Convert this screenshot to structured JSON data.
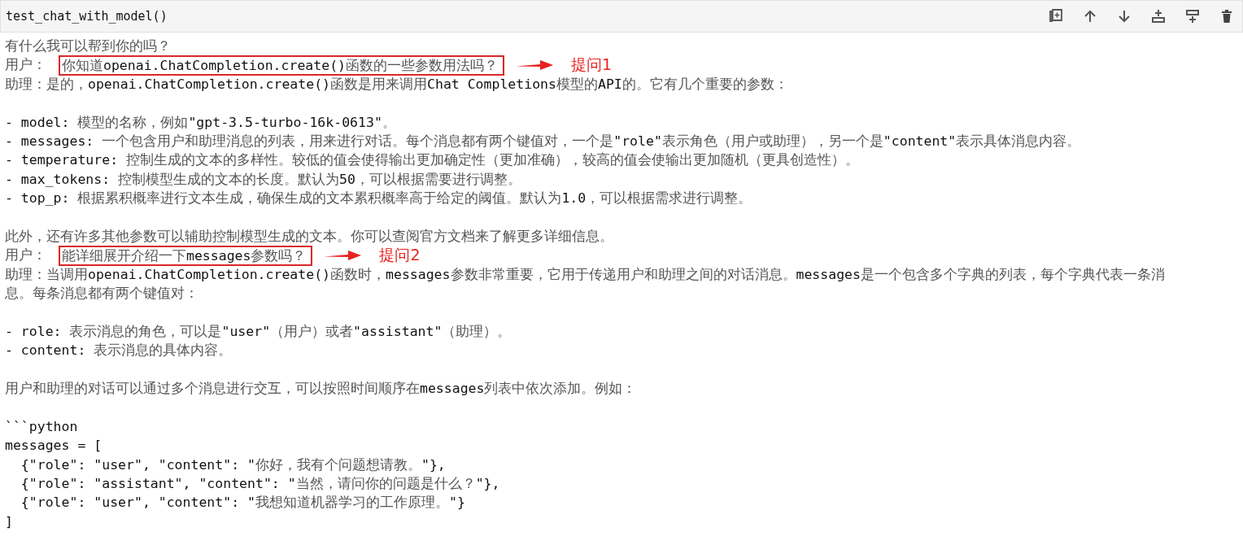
{
  "cell": {
    "code": "test_chat_with_model()"
  },
  "toolbar": [
    {
      "kind": "copy"
    },
    {
      "kind": "up"
    },
    {
      "kind": "down"
    },
    {
      "kind": "insert-above"
    },
    {
      "kind": "insert-below"
    },
    {
      "kind": "delete"
    }
  ],
  "output": [
    {
      "kind": "text",
      "text": "有什么我可以帮到你的吗？"
    },
    {
      "kind": "question",
      "speaker": "用户：",
      "text": "你知道openai.ChatCompletion.create()函数的一些参数用法吗？",
      "annotation": "提问1"
    },
    {
      "kind": "text",
      "text": "助理：是的，openai.ChatCompletion.create()函数是用来调用Chat Completions模型的API的。它有几个重要的参数："
    },
    {
      "kind": "gap"
    },
    {
      "kind": "text",
      "text": "- model: 模型的名称，例如\"gpt-3.5-turbo-16k-0613\"。"
    },
    {
      "kind": "text",
      "text": "- messages: 一个包含用户和助理消息的列表，用来进行对话。每个消息都有两个键值对，一个是\"role\"表示角色（用户或助理），另一个是\"content\"表示具体消息内容。"
    },
    {
      "kind": "text",
      "text": "- temperature: 控制生成的文本的多样性。较低的值会使得输出更加确定性（更加准确），较高的值会使输出更加随机（更具创造性）。"
    },
    {
      "kind": "text",
      "text": "- max_tokens: 控制模型生成的文本的长度。默认为50，可以根据需要进行调整。"
    },
    {
      "kind": "text",
      "text": "- top_p: 根据累积概率进行文本生成，确保生成的文本累积概率高于给定的阈值。默认为1.0，可以根据需求进行调整。"
    },
    {
      "kind": "gap"
    },
    {
      "kind": "text",
      "text": "此外，还有许多其他参数可以辅助控制模型生成的文本。你可以查阅官方文档来了解更多详细信息。"
    },
    {
      "kind": "question",
      "speaker": "用户：",
      "text": "能详细展开介绍一下messages参数吗？",
      "annotation": "提问2"
    },
    {
      "kind": "text",
      "text": "助理：当调用openai.ChatCompletion.create()函数时，messages参数非常重要，它用于传递用户和助理之间的对话消息。messages是一个包含多个字典的列表，每个字典代表一条消"
    },
    {
      "kind": "text",
      "text": "息。每条消息都有两个键值对："
    },
    {
      "kind": "gap"
    },
    {
      "kind": "text",
      "text": "- role: 表示消息的角色，可以是\"user\"（用户）或者\"assistant\"（助理）。"
    },
    {
      "kind": "text",
      "text": "- content: 表示消息的具体内容。"
    },
    {
      "kind": "gap"
    },
    {
      "kind": "text",
      "text": "用户和助理的对话可以通过多个消息进行交互，可以按照时间顺序在messages列表中依次添加。例如："
    },
    {
      "kind": "gap"
    },
    {
      "kind": "text",
      "text": "```python"
    },
    {
      "kind": "text",
      "text": "messages = ["
    },
    {
      "kind": "text",
      "text": "  {\"role\": \"user\", \"content\": \"你好，我有个问题想请教。\"},"
    },
    {
      "kind": "text",
      "text": "  {\"role\": \"assistant\", \"content\": \"当然，请问你的问题是什么？\"},"
    },
    {
      "kind": "text",
      "text": "  {\"role\": \"user\", \"content\": \"我想知道机器学习的工作原理。\"}"
    },
    {
      "kind": "text",
      "text": "]"
    }
  ]
}
